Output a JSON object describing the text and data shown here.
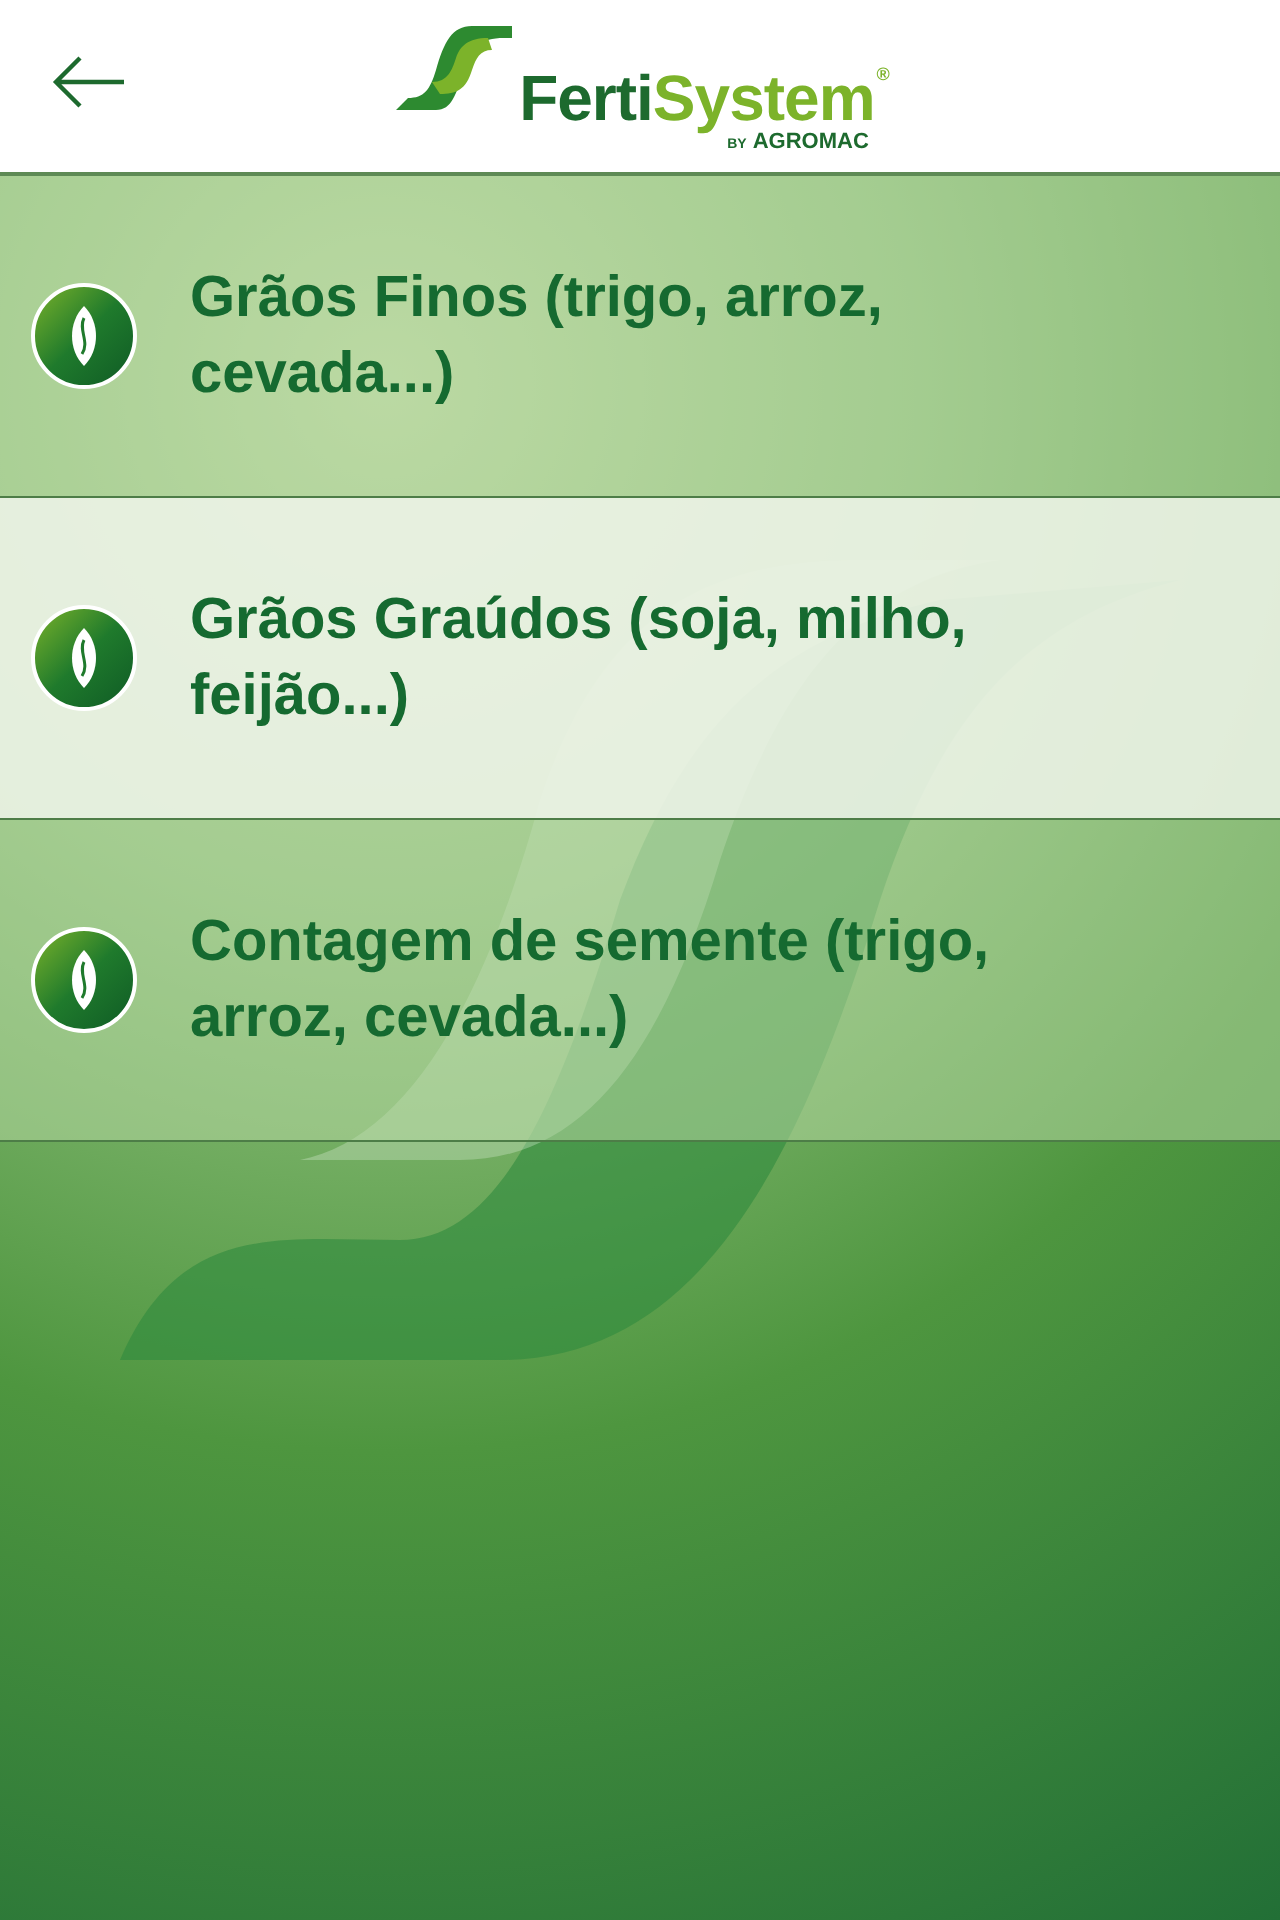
{
  "header": {
    "logo": {
      "part_1": "Ferti",
      "part_2": "System",
      "by": "BY",
      "brand": "AGROMAC",
      "mark": "®"
    }
  },
  "items": [
    {
      "label": "Grãos Finos (trigo, arroz, cevada...)",
      "selected": false
    },
    {
      "label": "Grãos Graúdos (soja, milho, feijão...)",
      "selected": true
    },
    {
      "label": "Contagem de semente (trigo, arroz, cevada...)",
      "selected": false
    }
  ]
}
